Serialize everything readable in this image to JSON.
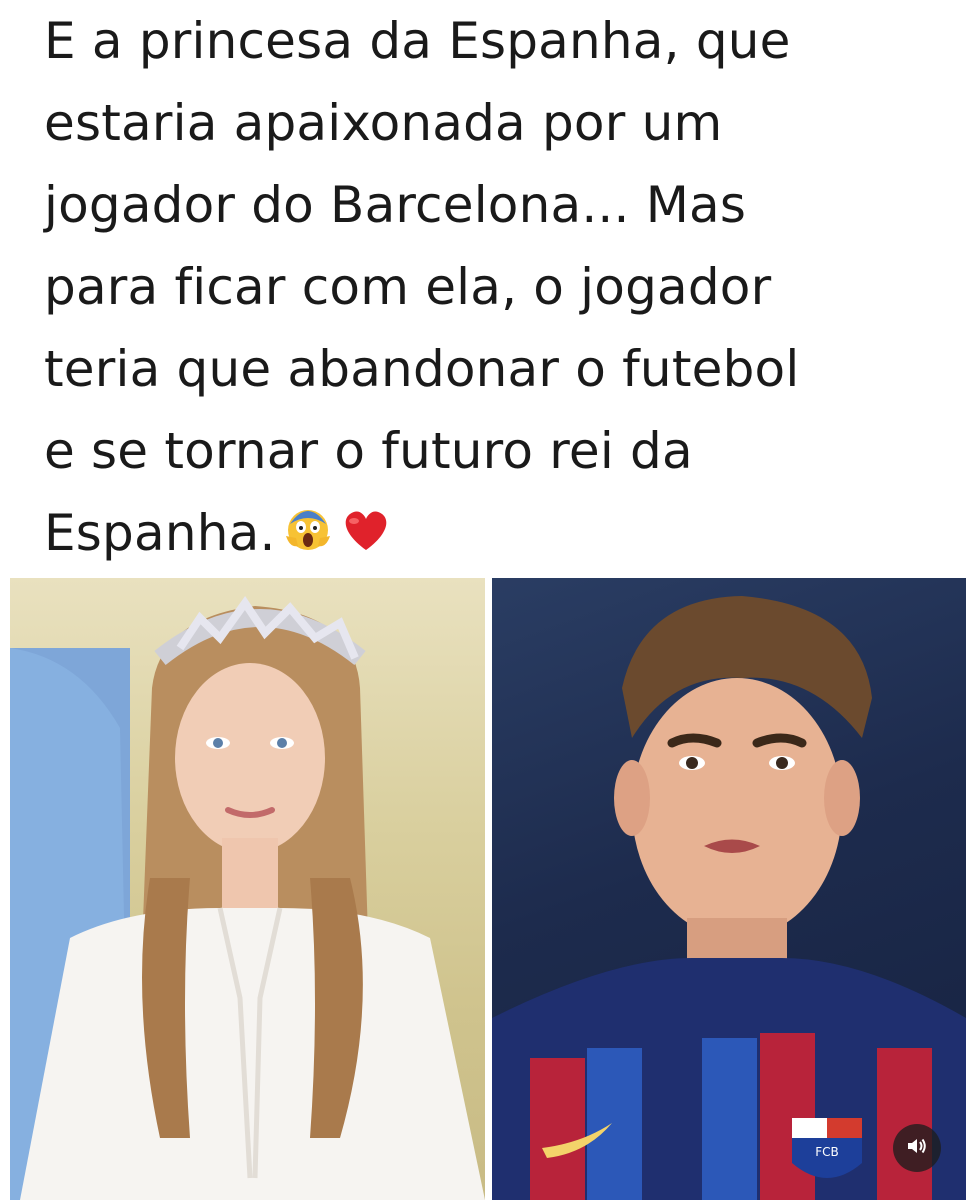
{
  "post": {
    "caption": "E a princesa da Espanha, que\nestaria apaixonada por um\njogador do Barcelona... Mas\npara ficar com ela, o jogador\nteria que abandonar o futebol\ne se tornar o futuro rei da\nEspanha.",
    "emojis": [
      "screaming-face-emoji",
      "red-heart-emoji"
    ]
  },
  "media": {
    "left_photo": "princess-with-tiara-photo",
    "right_photo": "football-player-barcelona-jersey-photo",
    "crest_text": "FCB",
    "sound_icon": "speaker-icon"
  }
}
